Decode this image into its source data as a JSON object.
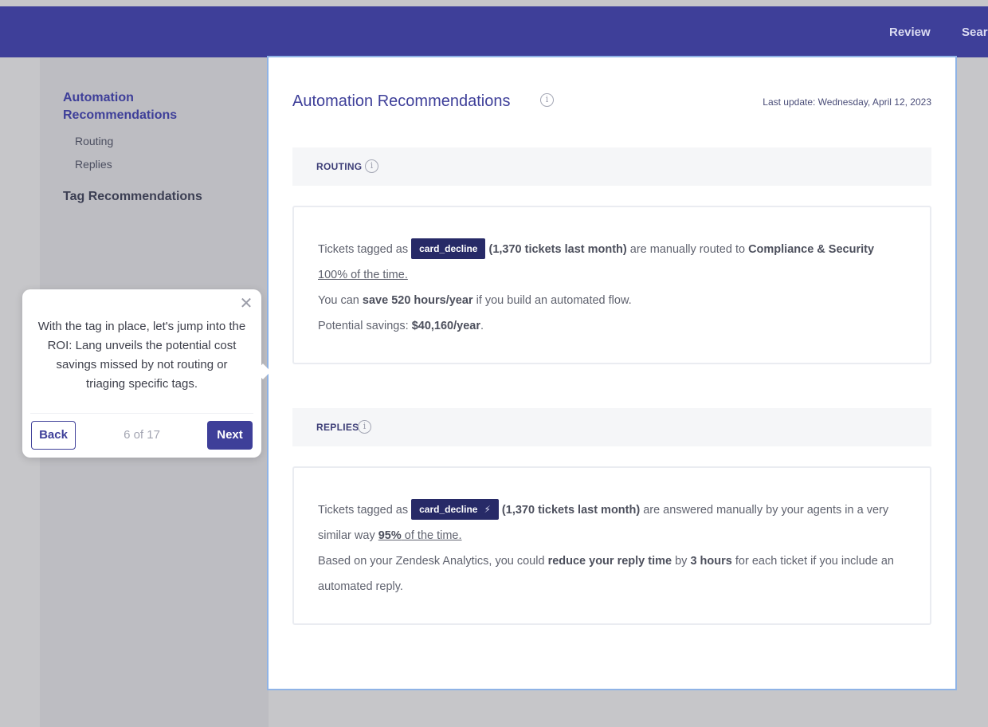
{
  "header": {
    "nav": [
      "Review",
      "Sear"
    ]
  },
  "sidebar": {
    "automation": "Automation Recommendations",
    "routing": "Routing",
    "replies": "Replies",
    "tag": "Tag Recommendations"
  },
  "main": {
    "title": "Automation Recommendations",
    "last_update": "Last update: Wednesday, April 12, 2023",
    "info_glyph": "i"
  },
  "routing": {
    "label": "ROUTING",
    "prefix": "Tickets tagged as",
    "tag": "card_decline",
    "count": "(1,370 tickets last month)",
    "text_mid": " are manually routed to ",
    "team": "Compliance & Security",
    "pct": "100% of the time.",
    "save_pre": "You can ",
    "save_bold": "save 520 hours/year",
    "save_post": " if you build an automated flow.",
    "pot_pre": "Potential savings: ",
    "pot_bold": "$40,160/year",
    "pot_post": "."
  },
  "replies": {
    "label": "REPLIES",
    "prefix": "Tickets tagged as",
    "tag": "card_decline",
    "bolt": "⚡",
    "count": "(1,370 tickets last month)",
    "text_mid": " are answered manually by your agents in a very",
    "l2_pre": "similar way ",
    "l2_pct": "95%",
    "l2_post": " of the time.",
    "l3_pre": "Based on your Zendesk Analytics, you could ",
    "l3_bold1": "reduce your reply time",
    "l3_mid": " by ",
    "l3_bold2": "3 hours",
    "l3_post": " for each ticket if you include an",
    "l4": "automated reply."
  },
  "tooltip": {
    "body": "With the tag in place, let's jump into the ROI: Lang unveils the potential cost savings missed by not routing or triaging specific tags.",
    "back": "Back",
    "count": "6 of 17",
    "next": "Next",
    "close": "✕"
  }
}
